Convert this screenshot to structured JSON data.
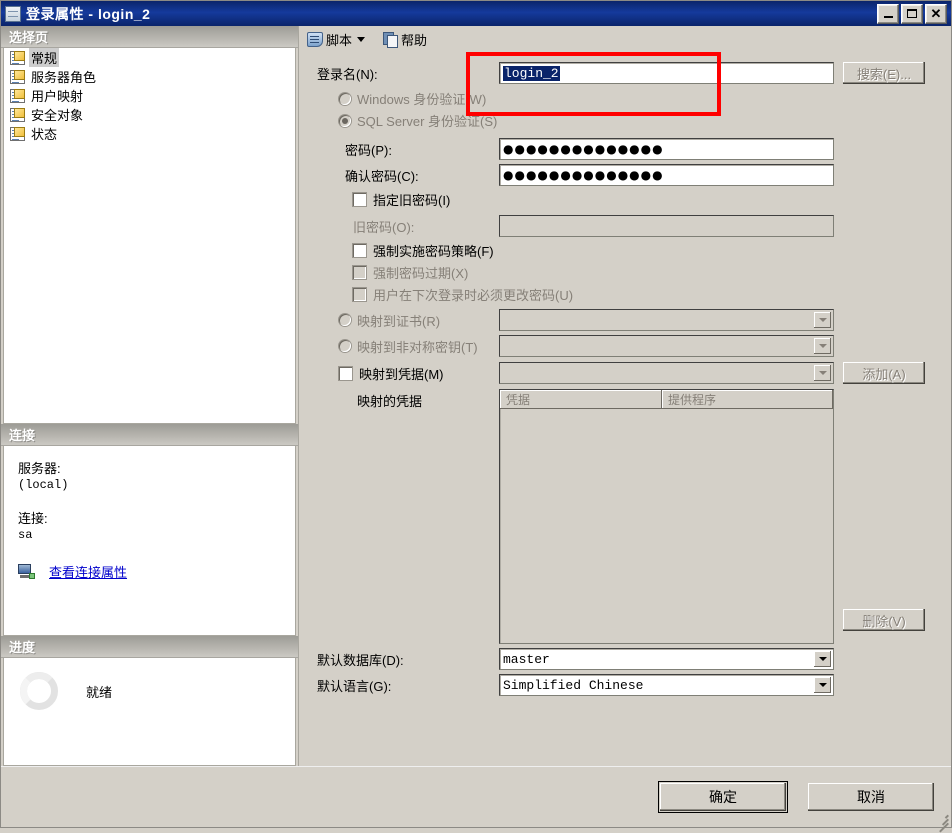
{
  "window": {
    "title": "登录属性 - login_2",
    "icon": "login-properties-icon",
    "minimize_label": "",
    "maximize_label": "",
    "close_label": "✕"
  },
  "sidebar": {
    "pages_header": "选择页",
    "items": [
      {
        "label": "常规",
        "selected": true
      },
      {
        "label": "服务器角色",
        "selected": false
      },
      {
        "label": "用户映射",
        "selected": false
      },
      {
        "label": "安全对象",
        "selected": false
      },
      {
        "label": "状态",
        "selected": false
      }
    ],
    "connection": {
      "header": "连接",
      "server_label": "服务器:",
      "server_value": "(local)",
      "connection_label": "连接:",
      "connection_value": "sa",
      "view_link": "查看连接属性"
    },
    "progress": {
      "header": "进度",
      "status": "就绪"
    }
  },
  "toolbar": {
    "script_label": "脚本",
    "help_label": "帮助"
  },
  "form": {
    "login_name_label": "登录名(N):",
    "login_name_value": "login_2",
    "search_button": "搜索(E)...",
    "windows_auth_label": "Windows 身份验证(W)",
    "sql_auth_label": "SQL Server 身份验证(S)",
    "password_label": "密码(P):",
    "password_value": "●●●●●●●●●●●●●●",
    "confirm_password_label": "确认密码(C):",
    "confirm_password_value": "●●●●●●●●●●●●●●",
    "specify_old_password_label": "指定旧密码(I)",
    "old_password_label": "旧密码(O):",
    "old_password_value": "",
    "enforce_policy_label": "强制实施密码策略(F)",
    "enforce_expiration_label": "强制密码过期(X)",
    "must_change_label": "用户在下次登录时必须更改密码(U)",
    "map_certificate_label": "映射到证书(R)",
    "map_certificate_value": "",
    "map_asymmetric_label": "映射到非对称密钥(T)",
    "map_asymmetric_value": "",
    "map_credential_label": "映射到凭据(M)",
    "map_credential_value": "",
    "add_button": "添加(A)",
    "mapped_credentials_label": "映射的凭据",
    "cred_col_credential": "凭据",
    "cred_col_provider": "提供程序",
    "cred_rows": [],
    "remove_button": "删除(V)",
    "default_database_label": "默认数据库(D):",
    "default_database_value": "master",
    "default_language_label": "默认语言(G):",
    "default_language_value": "Simplified Chinese"
  },
  "footer": {
    "ok_label": "确定",
    "cancel_label": "取消"
  },
  "annotation": {
    "color": "#ff0000",
    "target": "login-name-field"
  }
}
